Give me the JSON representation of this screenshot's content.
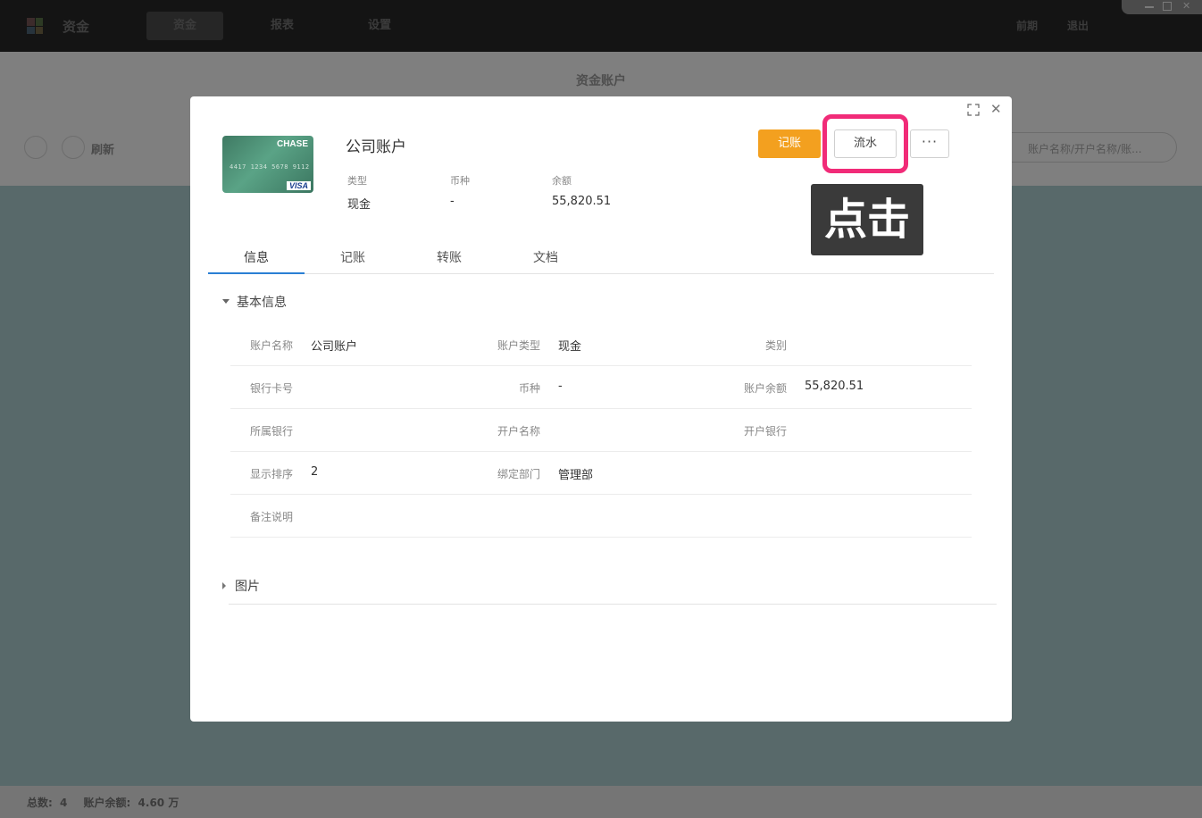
{
  "app": {
    "title": "资金",
    "nav": [
      "资金",
      "报表",
      "设置"
    ],
    "top_right": [
      "前期",
      "退出"
    ],
    "page_title": "资金账户",
    "toolbar": {
      "refresh_label": "刷新",
      "search_placeholder": "账户名称/开户名称/账..."
    },
    "footer": {
      "total_label": "总数:",
      "total_value": "4",
      "balance_label": "账户余额:",
      "balance_value": "4.60 万"
    }
  },
  "modal": {
    "card": {
      "brand": "CHASE",
      "number": "4417 1234 5678 9112",
      "network": "VISA"
    },
    "account_title": "公司账户",
    "meta": [
      {
        "label": "类型",
        "value": "现金"
      },
      {
        "label": "币种",
        "value": "-"
      },
      {
        "label": "余额",
        "value": "55,820.51"
      }
    ],
    "buttons": {
      "record": "记账",
      "flow": "流水",
      "more": "···"
    },
    "tooltip": "点击",
    "highlight_color": "#f12b78",
    "accent_color": "#f3a01f",
    "tabs": [
      "信息",
      "记账",
      "转账",
      "文档"
    ],
    "active_tab": "信息",
    "section_basic": "基本信息",
    "rows": [
      [
        {
          "label": "账户名称",
          "value": "公司账户"
        },
        {
          "label": "账户类型",
          "value": "现金"
        },
        {
          "label": "类别",
          "value": ""
        }
      ],
      [
        {
          "label": "银行卡号",
          "value": ""
        },
        {
          "label": "币种",
          "value": "-"
        },
        {
          "label": "账户余额",
          "value": "55,820.51"
        }
      ],
      [
        {
          "label": "所属银行",
          "value": ""
        },
        {
          "label": "开户名称",
          "value": ""
        },
        {
          "label": "开户银行",
          "value": ""
        }
      ],
      [
        {
          "label": "显示排序",
          "value": "2"
        },
        {
          "label": "绑定部门",
          "value": "管理部"
        }
      ],
      [
        {
          "label": "备注说明",
          "value": ""
        }
      ]
    ],
    "section_pictures": "图片"
  }
}
